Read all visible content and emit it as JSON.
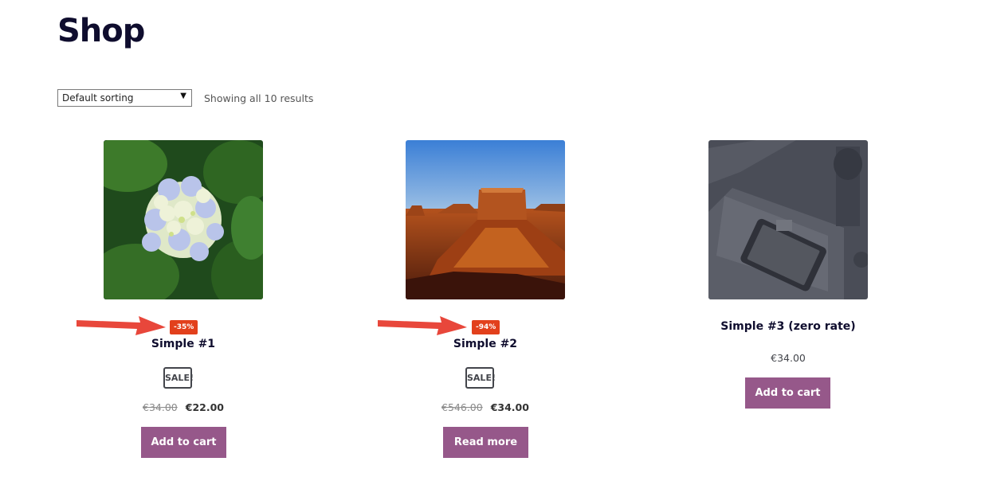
{
  "page": {
    "title": "Shop"
  },
  "toolbar": {
    "sort_selected": "Default sorting",
    "result_count": "Showing all 10 results"
  },
  "colors": {
    "title": "#0f0d2e",
    "button": "#96588a",
    "discount_badge": "#e2401c",
    "annotation_arrow": "#e8473b"
  },
  "products": [
    {
      "name": "Simple #1",
      "image": "hydrangea-flower-photo",
      "discount_badge": "-35%",
      "sale_badge": "SALE!",
      "price_old": "€34.00",
      "price_new": "€22.00",
      "button_label": "Add to cart"
    },
    {
      "name": "Simple #2",
      "image": "desert-butte-photo",
      "discount_badge": "-94%",
      "sale_badge": "SALE!",
      "price_old": "€546.00",
      "price_new": "€34.00",
      "button_label": "Read more"
    },
    {
      "name": "Simple #3 (zero rate)",
      "image": "desk-tablet-placeholder-photo",
      "price": "€34.00",
      "button_label": "Add to cart"
    }
  ],
  "annotations": {
    "arrow_icon": "red-arrow-icon"
  }
}
